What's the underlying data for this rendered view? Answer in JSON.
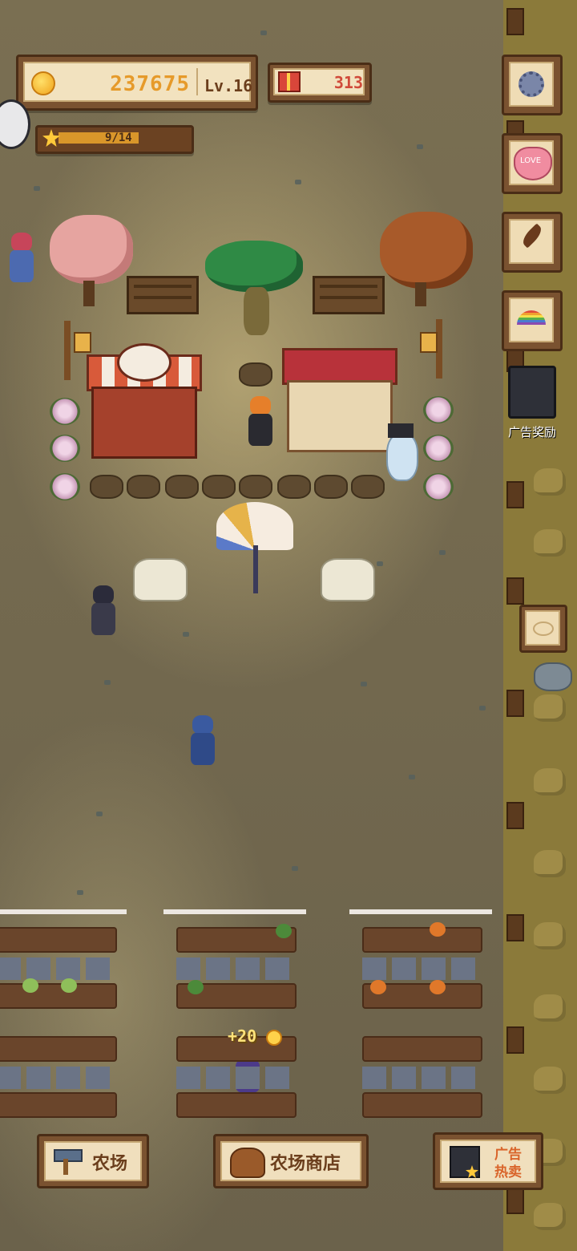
{
  "hud": {
    "coins": "237675",
    "level": "Lv.16",
    "gifts": "313",
    "star_progress": "9/14",
    "star_progress_fraction": 0.643
  },
  "side_menu": {
    "icons": [
      "gear-icon",
      "love-heart-icon",
      "feather-icon",
      "rainbow-icon"
    ],
    "heart_text": "LOVE",
    "ad_reward_label": "广告奖励"
  },
  "floating": {
    "coin_gain": "+20"
  },
  "bottom": {
    "farm_label": "农场",
    "shop_label": "农场商店",
    "ad_sale_label_line1": "广告",
    "ad_sale_label_line2": "热卖"
  },
  "colors": {
    "panel_wood": "#7a5230",
    "panel_cream": "#f2e2bf",
    "coin_text": "#e69a2a",
    "gift_text": "#d04a3a",
    "label_text": "#6b3e1c"
  }
}
